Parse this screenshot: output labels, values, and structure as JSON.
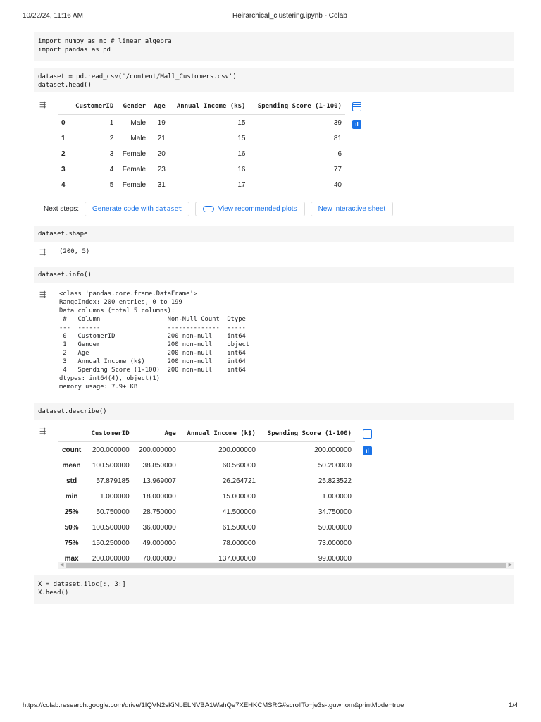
{
  "header": {
    "datetime": "10/22/24, 11:16 AM",
    "title": "Heirarchical_clustering.ipynb - Colab"
  },
  "footer": {
    "url": "https://colab.research.google.com/drive/1IQVN2sKiNbELNVBA1WahQe7XEHKCMSRG#scrollTo=je3s-tguwhom&printMode=true",
    "page": "1/4"
  },
  "cells": [
    {
      "code": "import numpy as np # linear algebra\nimport pandas as pd"
    },
    {
      "code": "dataset = pd.read_csv('/content/Mall_Customers.csv')\ndataset.head()"
    },
    {
      "code": "dataset.shape"
    },
    {
      "code": "dataset.info()"
    },
    {
      "code": "dataset.describe()"
    },
    {
      "code": "X = dataset.iloc[:, 3:]\nX.head()"
    }
  ],
  "head_table": {
    "columns": [
      "",
      "CustomerID",
      "Gender",
      "Age",
      "Annual Income (k$)",
      "Spending Score (1-100)"
    ],
    "rows": [
      [
        "0",
        "1",
        "Male",
        "19",
        "15",
        "39"
      ],
      [
        "1",
        "2",
        "Male",
        "21",
        "15",
        "81"
      ],
      [
        "2",
        "3",
        "Female",
        "20",
        "16",
        "6"
      ],
      [
        "3",
        "4",
        "Female",
        "23",
        "16",
        "77"
      ],
      [
        "4",
        "5",
        "Female",
        "31",
        "17",
        "40"
      ]
    ]
  },
  "next_steps": {
    "label": "Next steps:",
    "generate": "Generate code with ",
    "generate_var": "dataset",
    "plots": "View recommended plots",
    "sheet": "New interactive sheet"
  },
  "shape_output": "(200, 5)",
  "info_output": "<class 'pandas.core.frame.DataFrame'>\nRangeIndex: 200 entries, 0 to 199\nData columns (total 5 columns):\n #   Column                  Non-Null Count  Dtype \n---  ------                  --------------  ----- \n 0   CustomerID              200 non-null    int64 \n 1   Gender                  200 non-null    object\n 2   Age                     200 non-null    int64 \n 3   Annual Income (k$)      200 non-null    int64 \n 4   Spending Score (1-100)  200 non-null    int64 \ndtypes: int64(4), object(1)\nmemory usage: 7.9+ KB",
  "describe_table": {
    "columns": [
      "",
      "CustomerID",
      "Age",
      "Annual Income (k$)",
      "Spending Score (1-100)"
    ],
    "rows": [
      [
        "count",
        "200.000000",
        "200.000000",
        "200.000000",
        "200.000000"
      ],
      [
        "mean",
        "100.500000",
        "38.850000",
        "60.560000",
        "50.200000"
      ],
      [
        "std",
        "57.879185",
        "13.969007",
        "26.264721",
        "25.823522"
      ],
      [
        "min",
        "1.000000",
        "18.000000",
        "15.000000",
        "1.000000"
      ],
      [
        "25%",
        "50.750000",
        "28.750000",
        "41.500000",
        "34.750000"
      ],
      [
        "50%",
        "100.500000",
        "36.000000",
        "61.500000",
        "50.000000"
      ],
      [
        "75%",
        "150.250000",
        "49.000000",
        "78.000000",
        "73.000000"
      ],
      [
        "max",
        "200.000000",
        "70.000000",
        "137.000000",
        "99.000000"
      ]
    ]
  },
  "colors": {
    "accent": "#1a73e8",
    "cell_bg": "#f5f5f5"
  }
}
